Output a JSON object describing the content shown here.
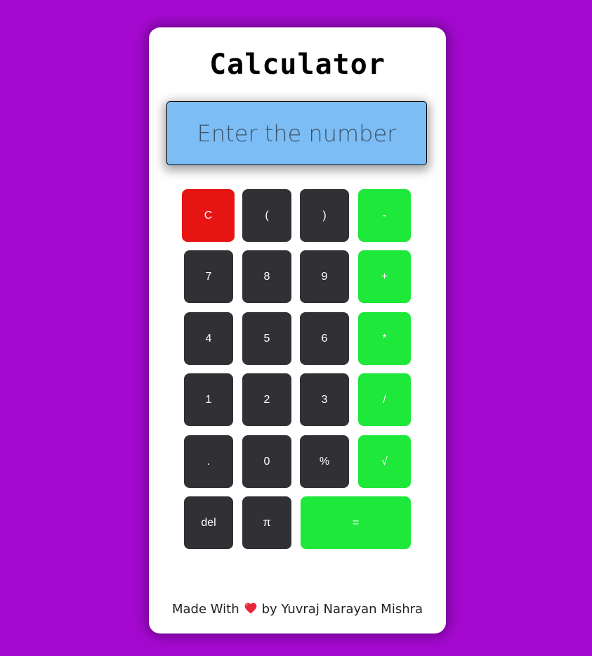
{
  "app": {
    "title": "Calculator"
  },
  "display": {
    "placeholder": "Enter the number",
    "value": ""
  },
  "buttons": {
    "clear": "C",
    "open_paren": "(",
    "close_paren": ")",
    "minus": "-",
    "seven": "7",
    "eight": "8",
    "nine": "9",
    "plus": "+",
    "four": "4",
    "five": "5",
    "six": "6",
    "multiply": "*",
    "one": "1",
    "two": "2",
    "three": "3",
    "divide": "/",
    "dot": ".",
    "zero": "0",
    "percent": "%",
    "sqrt": "√",
    "del": "del",
    "pi": "π",
    "equals": "="
  },
  "footer": {
    "made_with": "Made With",
    "heart_icon": "heart-icon",
    "by": "by Yuvraj Narayan Mishra"
  },
  "colors": {
    "background": "#a509d0",
    "display": "#7cbdf5",
    "dark_button": "#313035",
    "operator_button": "#1ee83a",
    "clear_button": "#e71414"
  }
}
